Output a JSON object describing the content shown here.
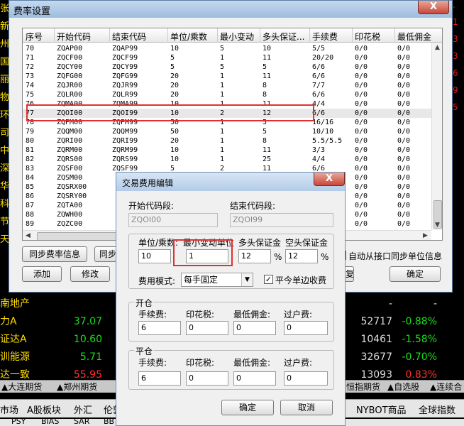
{
  "background": {
    "left_chars": [
      "张",
      "新",
      "州",
      "国",
      "丽",
      "物",
      "环",
      "司",
      "中",
      "深",
      "华",
      "科",
      "节",
      "天"
    ],
    "rows": [
      {
        "name": "南地产",
        "v1": "",
        "v2": "",
        "v3": "",
        "v1c": "",
        "v3c": ""
      },
      {
        "name": "力A",
        "v1": "37.07",
        "v2": "52717",
        "v3": "-0.88%",
        "v1c": "green",
        "v3c": "green"
      },
      {
        "name": "证达A",
        "v1": "10.60",
        "v2": "10461",
        "v3": "-1.58%",
        "v1c": "green",
        "v3c": "green"
      },
      {
        "name": "训能源",
        "v1": "5.71",
        "v2": "32677",
        "v3": "-0.70%",
        "v1c": "green",
        "v3c": "green"
      },
      {
        "name": "达一致",
        "v1": "55.95",
        "v2": "13093",
        "v3": "0.83%",
        "v1c": "red",
        "v3c": "red"
      }
    ],
    "row_dashes": [
      "-",
      "-"
    ],
    "tabs_left": [
      "▲大连期货",
      "▲郑州期货"
    ],
    "tabs_right": [
      "恒指期货",
      "▲自选股",
      "▲连续合"
    ],
    "categories": [
      "市场",
      "A股板块",
      "外汇",
      "伦敦",
      "NYBOT商品",
      "全球指数"
    ],
    "bottom_items": [
      "PSY",
      "BIAS",
      "SAR",
      "BB"
    ]
  },
  "outer_dialog": {
    "title": "费率设置",
    "close_glyph": "X",
    "columns": [
      "序号",
      "开始代码",
      "结束代码",
      "单位/乘数",
      "最小变动",
      "多头保证...",
      "手续费",
      "印花税",
      "最低佣金"
    ],
    "rows": [
      [
        "70",
        "ZQAP00",
        "ZQAP99",
        "10",
        "5",
        "10",
        "5/5",
        "0/0",
        "0/0"
      ],
      [
        "71",
        "ZQCF00",
        "ZQCF99",
        "5",
        "1",
        "11",
        "20/20",
        "0/0",
        "0/0"
      ],
      [
        "72",
        "ZQCY00",
        "ZQCY99",
        "5",
        "5",
        "5",
        "6/6",
        "0/0",
        "0/0"
      ],
      [
        "73",
        "ZQFG00",
        "ZQFG99",
        "20",
        "1",
        "11",
        "6/6",
        "0/0",
        "0/0"
      ],
      [
        "74",
        "ZQJR00",
        "ZQJR99",
        "20",
        "1",
        "8",
        "7/7",
        "0/0",
        "0/0"
      ],
      [
        "75",
        "ZQLR00",
        "ZQLR99",
        "20",
        "1",
        "8",
        "6/6",
        "0/0",
        "0/0"
      ],
      [
        "76",
        "ZQMA00",
        "ZQMA99",
        "10",
        "1",
        "11",
        "4/4",
        "0/0",
        "0/0"
      ],
      [
        "77",
        "ZQOI00",
        "ZQOI99",
        "10",
        "2",
        "12",
        "6/6",
        "0/0",
        "0/0"
      ],
      [
        "78",
        "ZQPM00",
        "ZQPM99",
        "50",
        "1",
        "5",
        "16/16",
        "0/0",
        "0/0"
      ],
      [
        "79",
        "ZQQM00",
        "ZQQM99",
        "50",
        "1",
        "5",
        "10/10",
        "0/0",
        "0/0"
      ],
      [
        "80",
        "ZQRI00",
        "ZQRI99",
        "20",
        "1",
        "8",
        "5.5/5.5",
        "0/0",
        "0/0"
      ],
      [
        "81",
        "ZQRM00",
        "ZQRM99",
        "10",
        "1",
        "11",
        "3/3",
        "0/0",
        "0/0"
      ],
      [
        "82",
        "ZQRS00",
        "ZQRS99",
        "10",
        "1",
        "25",
        "4/4",
        "0/0",
        "0/0"
      ],
      [
        "83",
        "ZQSF00",
        "ZQSF99",
        "5",
        "2",
        "11",
        "6/6",
        "0/0",
        "0/0"
      ],
      [
        "84",
        "ZQSM00",
        "",
        "",
        "",
        "",
        "",
        "0/0",
        "0/0"
      ],
      [
        "85",
        "ZQSRX00",
        "",
        "",
        "",
        "",
        "",
        "0/0",
        "0/0"
      ],
      [
        "86",
        "ZQSRY00",
        "",
        "",
        "",
        "",
        "",
        "0/0",
        "0/0"
      ],
      [
        "87",
        "ZQTA00",
        "",
        "",
        "",
        "",
        "",
        "0/0",
        "0/0"
      ],
      [
        "88",
        "ZQWH00",
        "",
        "",
        "",
        "",
        "",
        "0/0",
        "0/0"
      ],
      [
        "89",
        "ZQZC00",
        "",
        "",
        "",
        "",
        "",
        "0/0",
        "0/0"
      ]
    ],
    "selected_row_index": 7,
    "sync_rate_button": "同步费率信息",
    "sync_button_partial": "同步",
    "add_button": "添加",
    "modify_button": "修改",
    "delete_partial": "删",
    "auto_sync_label": "自动从接口同步单位信息",
    "auto_sync_checked": true,
    "ok_button": "确定",
    "partial_button": "复"
  },
  "inner_dialog": {
    "title": "交易费用编辑",
    "close_glyph": "X",
    "start_code_label": "开始代码段:",
    "start_code_value": "ZQOI00",
    "end_code_label": "结束代码段:",
    "end_code_value": "ZQOI99",
    "unit_label": "单位/乘数:",
    "unit_value": "10",
    "min_change_label": "最小变动单位",
    "min_change_value": "1",
    "long_margin_label": "多头保证金",
    "long_margin_value": "12",
    "short_margin_label": "空头保证金",
    "short_margin_value": "12",
    "percent": "%",
    "fee_mode_label": "费用模式:",
    "fee_mode_value": "每手固定",
    "close_today_label": "平今单边收费",
    "close_today_checked": true,
    "open_group": "开仓",
    "close_group": "平仓",
    "fee_label": "手续费:",
    "stamp_label": "印花税:",
    "min_comm_label": "最低佣金:",
    "transfer_label": "过户费:",
    "open_fee": "6",
    "open_stamp": "0",
    "open_min": "0",
    "open_transfer": "0",
    "close_fee": "6",
    "close_stamp": "0",
    "close_min": "0",
    "close_transfer": "0",
    "ok_button": "确定",
    "cancel_button": "取消"
  }
}
